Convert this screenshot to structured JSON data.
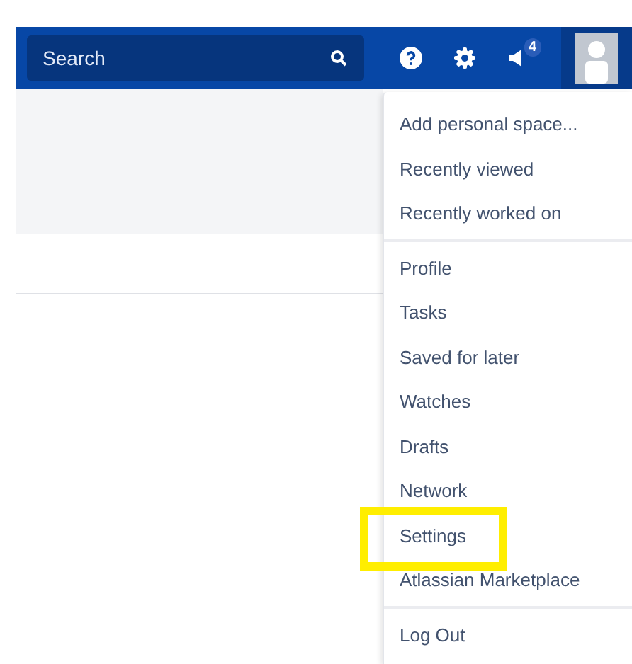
{
  "header": {
    "search": {
      "placeholder": "Search"
    },
    "notifications": {
      "count": "4"
    }
  },
  "user_menu": {
    "sections": [
      {
        "items": [
          {
            "label": "Add personal space...",
            "highlighted": false
          },
          {
            "label": "Recently viewed",
            "highlighted": false
          },
          {
            "label": "Recently worked on",
            "highlighted": false
          }
        ]
      },
      {
        "items": [
          {
            "label": "Profile",
            "highlighted": false
          },
          {
            "label": "Tasks",
            "highlighted": false
          },
          {
            "label": "Saved for later",
            "highlighted": false
          },
          {
            "label": "Watches",
            "highlighted": false
          },
          {
            "label": "Drafts",
            "highlighted": false
          },
          {
            "label": "Network",
            "highlighted": false
          },
          {
            "label": "Settings",
            "highlighted": true
          },
          {
            "label": "Atlassian Marketplace",
            "highlighted": false
          }
        ]
      },
      {
        "items": [
          {
            "label": "Log Out",
            "highlighted": false
          }
        ]
      }
    ]
  }
}
